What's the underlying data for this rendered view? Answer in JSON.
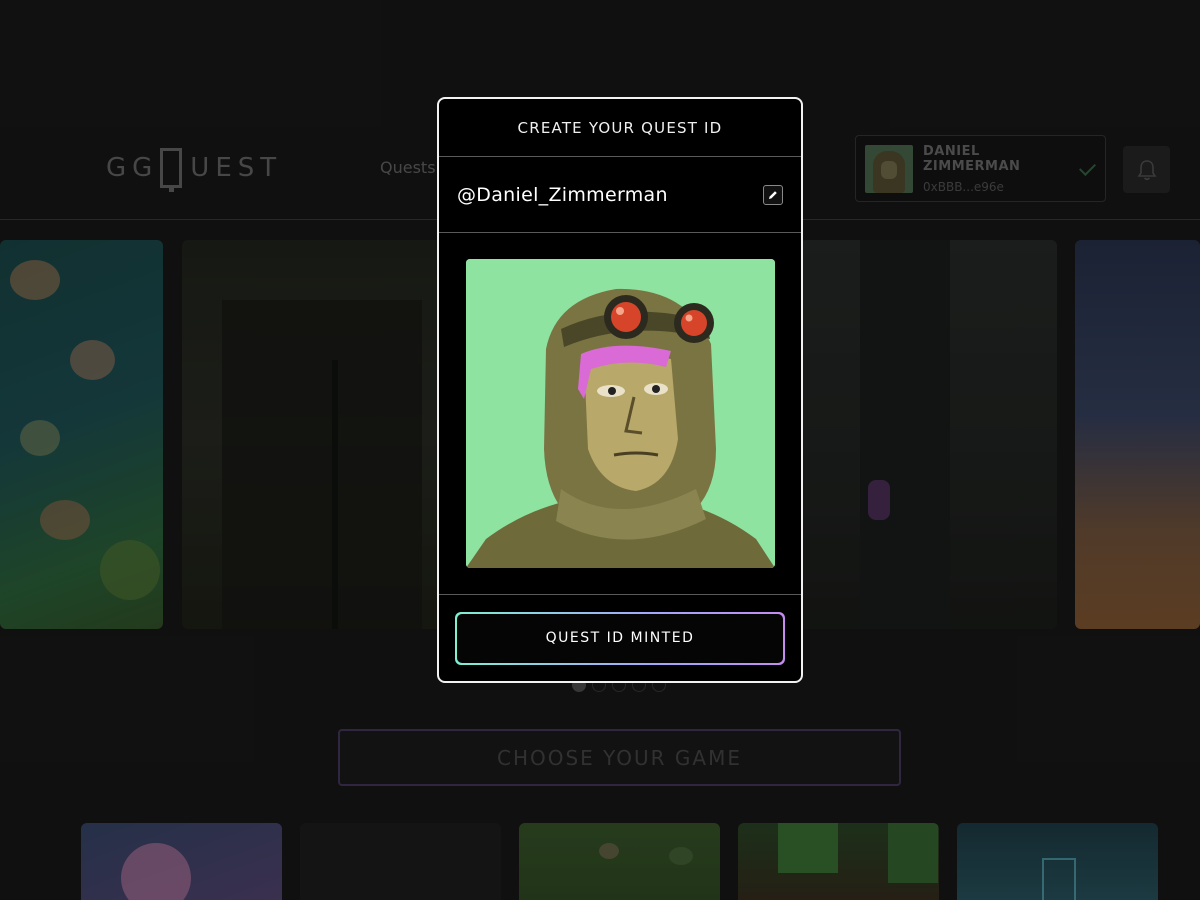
{
  "header": {
    "logo": {
      "left": "GG",
      "right": "UEST"
    },
    "nav_link": "Quests",
    "user": {
      "name": "DANIEL ZIMMERMAN",
      "wallet": "0xBBB...e96e"
    }
  },
  "carousel": {
    "active_index": 0,
    "dot_count": 5
  },
  "choose_game_label": "CHOOSE YOUR GAME",
  "modal": {
    "title": "CREATE YOUR QUEST ID",
    "handle": "@Daniel_Zimmerman",
    "button_label": "QUEST ID MINTED"
  },
  "colors": {
    "avatar_background": "#8ee3a0",
    "button_gradient_start": "#7ff0d0",
    "button_gradient_end": "#c58bf0",
    "choose_border": "#4a3b66"
  },
  "icons": [
    "edit-pencil-icon",
    "check-icon",
    "bell-icon"
  ]
}
